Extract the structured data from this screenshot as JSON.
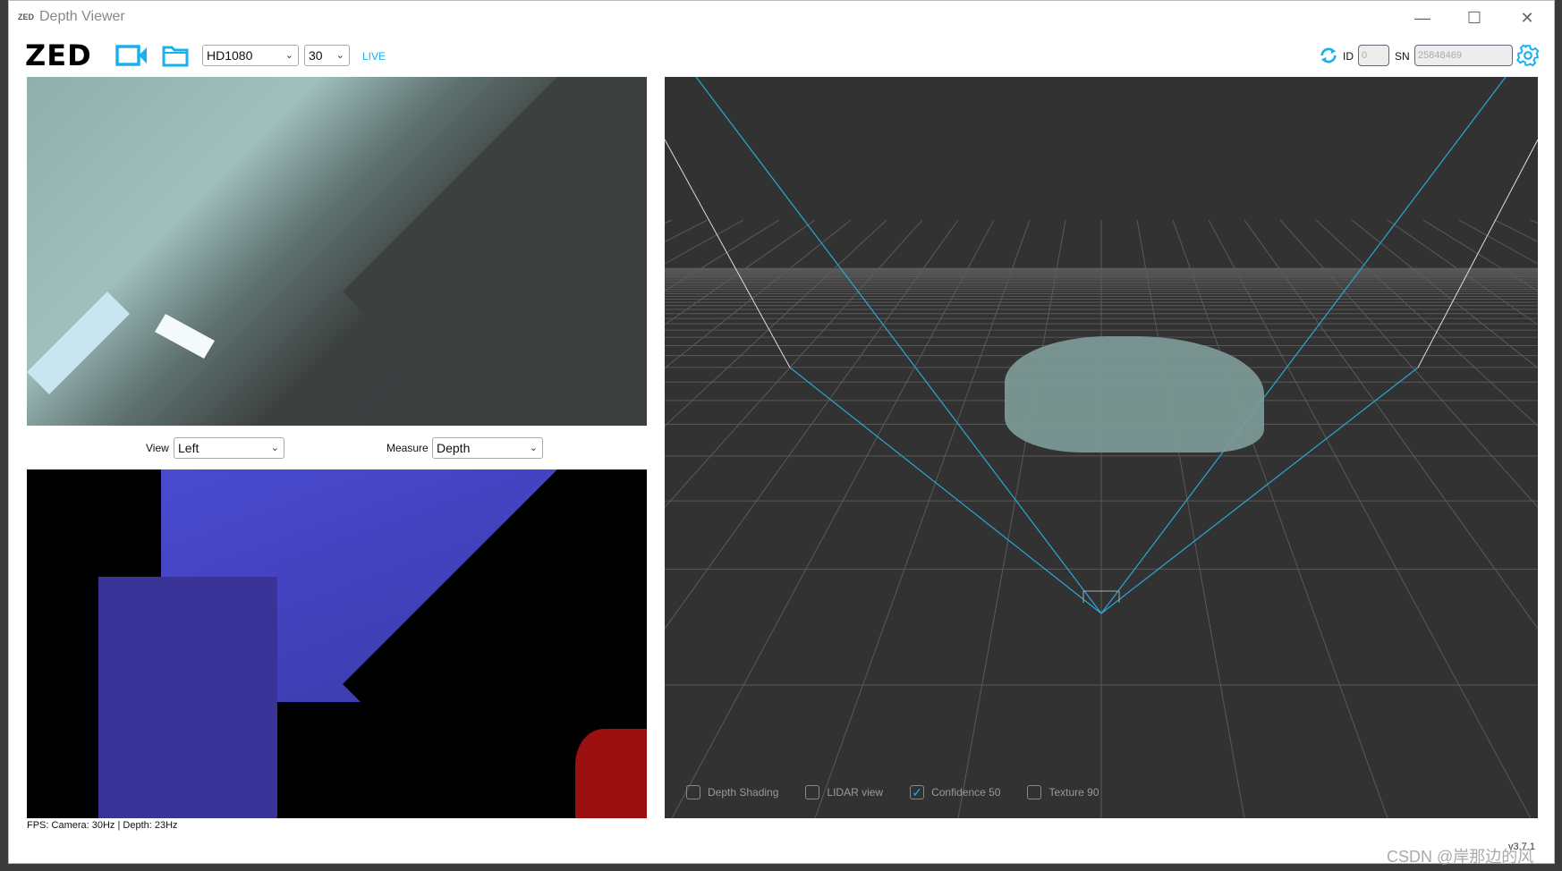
{
  "window": {
    "title": "Depth Viewer",
    "icon_text": "ZED",
    "minimize": "—",
    "maximize": "☐",
    "close": "✕"
  },
  "toolbar": {
    "logo": "ZED",
    "resolution": "HD1080",
    "fps": "30",
    "live": "LIVE",
    "id_label": "ID",
    "id_value": "0",
    "sn_label": "SN",
    "sn_value": "25848469"
  },
  "colors": {
    "accent": "#1ab0f0",
    "frustum": "#2aa8d8",
    "panel": "#323232"
  },
  "controls": {
    "view_label": "View",
    "view_value": "Left",
    "measure_label": "Measure",
    "measure_value": "Depth"
  },
  "view3d": {
    "checkboxes": [
      {
        "label": "Depth Shading",
        "checked": false
      },
      {
        "label": "LIDAR view",
        "checked": false
      },
      {
        "label": "Confidence 50",
        "checked": true
      },
      {
        "label": "Texture 90",
        "checked": false
      }
    ]
  },
  "status": {
    "fps": "FPS: Camera: 30Hz | Depth: 23Hz",
    "version": "v3.7.1"
  },
  "watermark": "CSDN @岸那边的风"
}
